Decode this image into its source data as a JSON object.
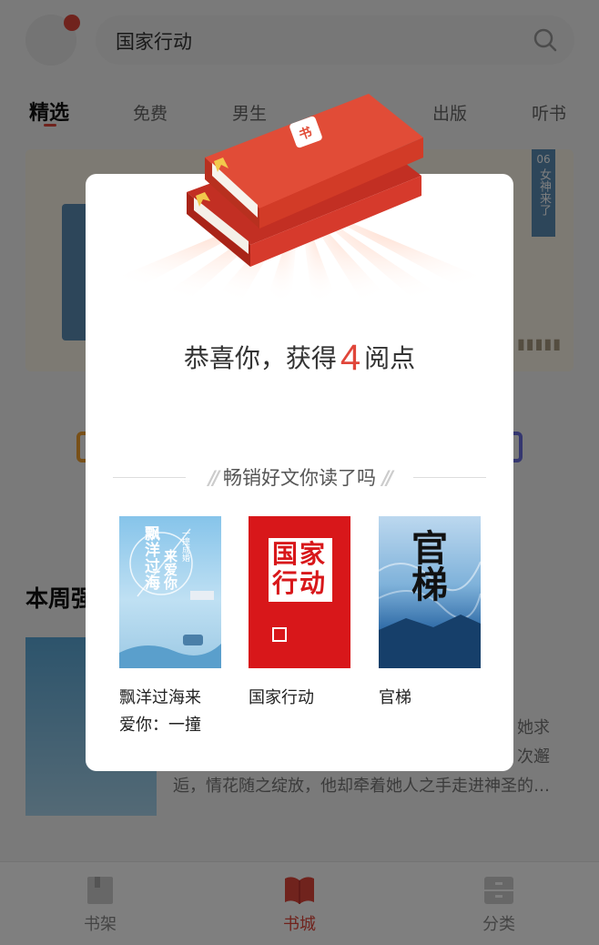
{
  "search": {
    "query": "国家行动"
  },
  "tabs": [
    {
      "label": "精选",
      "active": true
    },
    {
      "label": "免费"
    },
    {
      "label": "男生"
    },
    {
      "label": "出版"
    },
    {
      "label": "听书"
    }
  ],
  "banner": {
    "ribbon_number": "06",
    "ribbon_text": "女神来了"
  },
  "section": {
    "title": "本周强"
  },
  "feature": {
    "desc_line1": "她求",
    "desc_line2": "次邂",
    "desc_line3": "逅，情花随之绽放，他却牵着她人之手走进神圣的…"
  },
  "modal": {
    "congrats_prefix": "恭喜你，获得",
    "points": "4",
    "congrats_suffix": "阅点",
    "recommend_title": "畅销好文你读了吗",
    "books": [
      {
        "title": "飘洋过海来爱你：一撞",
        "cover_text_main": "飘洋过海",
        "cover_text_sub": "来爱你",
        "cover_tag": "一撞成婚"
      },
      {
        "title": "国家行动",
        "cover_text_main": "国家",
        "cover_text_sub": "行动"
      },
      {
        "title": "官梯",
        "cover_text_main": "官梯"
      }
    ]
  },
  "bottom_nav": [
    {
      "label": "书架",
      "active": false
    },
    {
      "label": "书城",
      "active": true
    },
    {
      "label": "分类",
      "active": false
    }
  ],
  "colors": {
    "accent": "#e0463a",
    "overlay": "rgba(0,0,0,0.5)"
  }
}
